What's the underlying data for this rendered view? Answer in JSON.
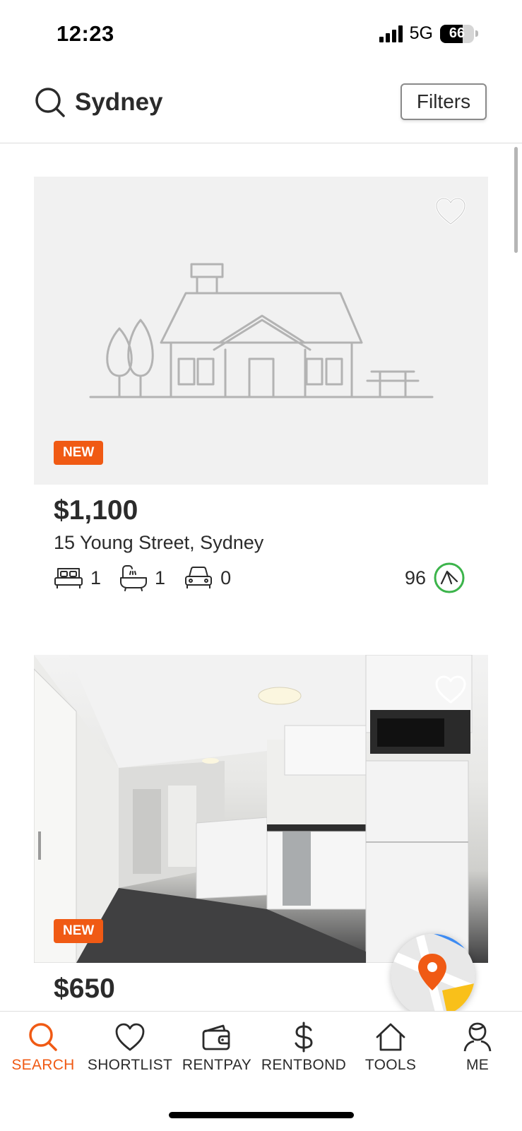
{
  "status_bar": {
    "time": "12:23",
    "network": "5G",
    "battery": "66",
    "battery_level": 0.66
  },
  "search": {
    "query": "Sydney",
    "icon": "search-icon",
    "filters_label": "Filters"
  },
  "listings": [
    {
      "badge": "NEW",
      "price": "$1,100",
      "address": "15 Young Street, Sydney",
      "beds": "1",
      "baths": "1",
      "parking": "0",
      "score": "96",
      "image": "placeholder-house",
      "shortlisted": false
    },
    {
      "badge": "NEW",
      "price": "$650",
      "image": "kitchen-photo",
      "shortlisted": false
    }
  ],
  "map_button_icon": "map-icon",
  "nav": {
    "items": [
      {
        "label": "SEARCH",
        "icon": "search-icon",
        "active": true
      },
      {
        "label": "SHORTLIST",
        "icon": "heart-icon",
        "active": false
      },
      {
        "label": "RENTPAY",
        "icon": "wallet-icon",
        "active": false
      },
      {
        "label": "RENTBOND",
        "icon": "dollar-icon",
        "active": false
      },
      {
        "label": "TOOLS",
        "icon": "home-icon",
        "active": false
      },
      {
        "label": "ME",
        "icon": "person-icon",
        "active": false
      }
    ]
  },
  "colors": {
    "accent": "#f05a14",
    "text": "#2b2b2b",
    "score_ring": "#3cb44b",
    "placeholder_bg": "#f1f1f1"
  }
}
